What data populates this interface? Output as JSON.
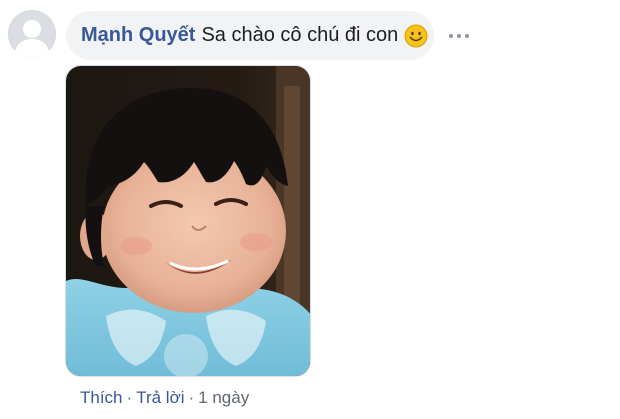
{
  "comment": {
    "author": "Mạnh Quyết",
    "text": "Sa chào cô chú đi con",
    "emoji": "smiling-face-icon",
    "colors": {
      "author": "#385898",
      "bubble_bg": "#f2f3f5",
      "link": "#385898",
      "meta": "#606770"
    }
  },
  "actions": {
    "like_label": "Thích",
    "reply_label": "Trả lời",
    "separator": "·",
    "timestamp": "1 ngày"
  },
  "icons": {
    "avatar": "default-avatar-silhouette",
    "more": "more-options-icon"
  }
}
